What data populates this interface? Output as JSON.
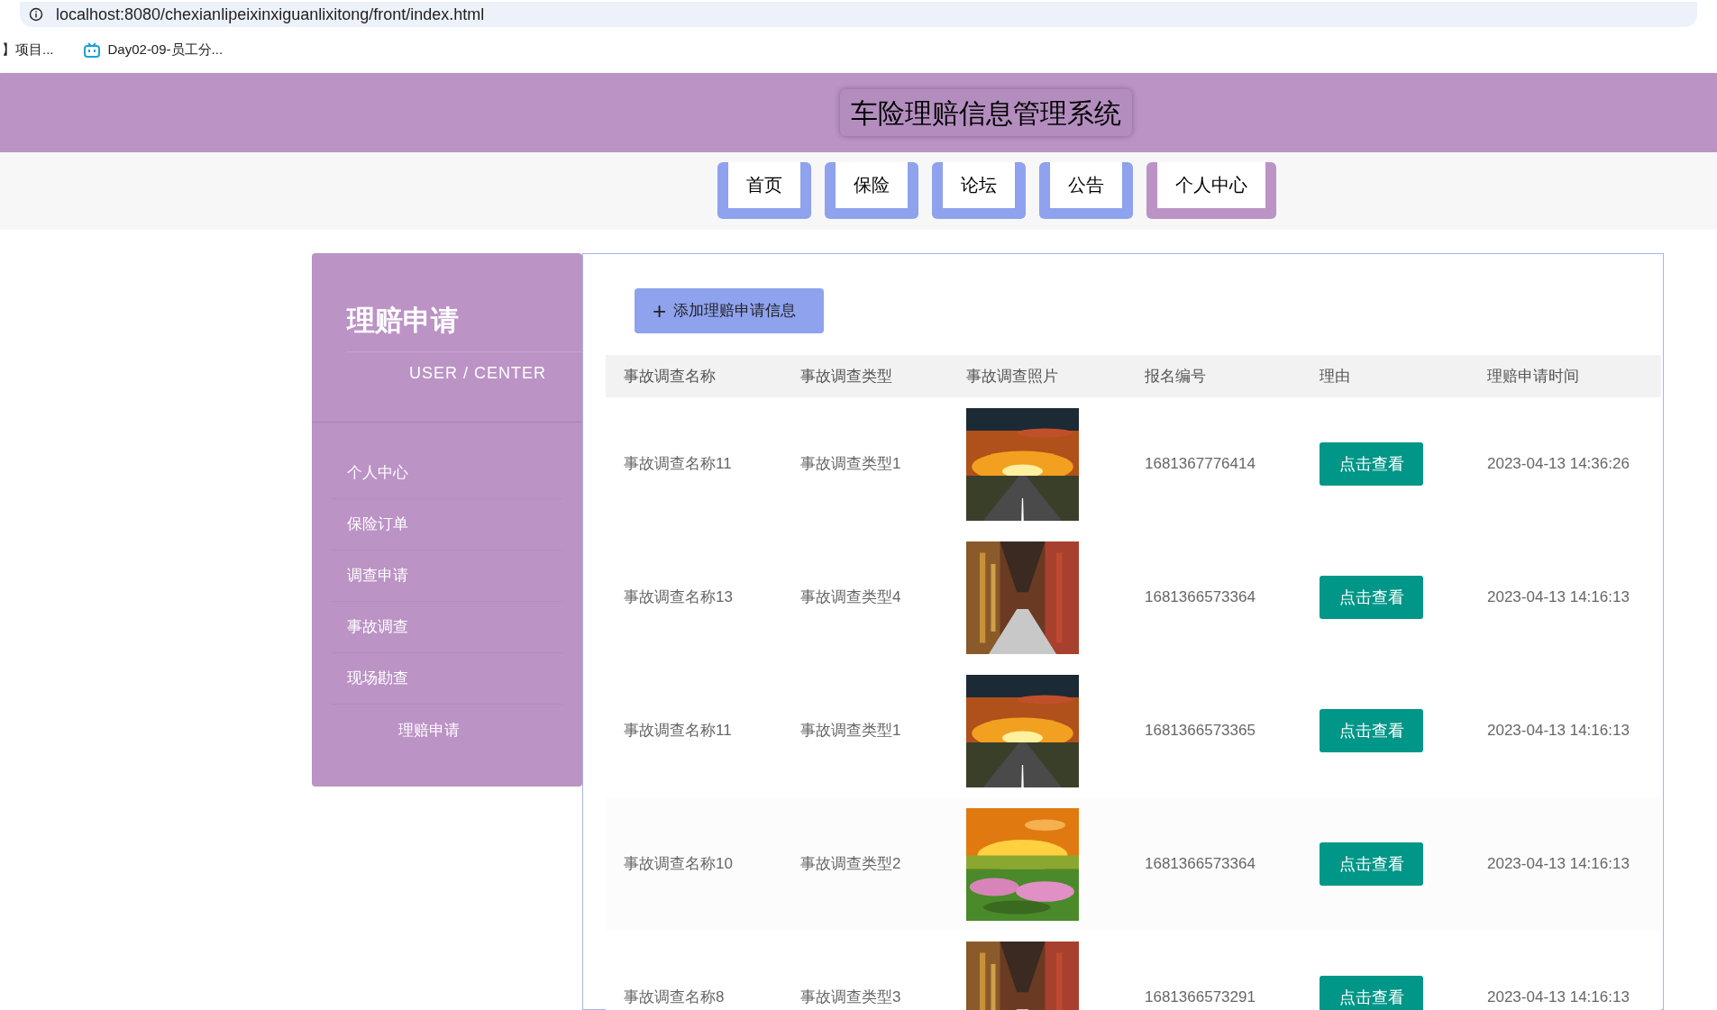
{
  "browser": {
    "url": "localhost:8080/chexianlipeixinxiguanlixitong/front/index.html",
    "bookmarks": [
      "】项目...",
      "Day02-09-员工分..."
    ]
  },
  "header": {
    "title": "车险理赔信息管理系统"
  },
  "nav": [
    {
      "label": "首页",
      "selected": false
    },
    {
      "label": "保险",
      "selected": false
    },
    {
      "label": "论坛",
      "selected": false
    },
    {
      "label": "公告",
      "selected": false
    },
    {
      "label": "个人中心",
      "selected": true
    }
  ],
  "sidebar": {
    "title": "理赔申请",
    "subtitle": "USER / CENTER",
    "items": [
      {
        "label": "个人中心",
        "selected": false
      },
      {
        "label": "保险订单",
        "selected": false
      },
      {
        "label": "调查申请",
        "selected": false
      },
      {
        "label": "事故调查",
        "selected": false
      },
      {
        "label": "现场勘查",
        "selected": false
      },
      {
        "label": "理赔申请",
        "selected": true
      }
    ]
  },
  "add_button": {
    "icon": "+",
    "label": "添加理赔申请信息"
  },
  "table": {
    "columns": [
      "事故调查名称",
      "事故调查类型",
      "事故调查照片",
      "报名编号",
      "理由",
      "理赔申请时间"
    ],
    "rows": [
      {
        "name": "事故调查名称11",
        "type": "事故调查类型1",
        "photo": {
          "kind": "road"
        },
        "number": "1681367776414",
        "reason": "点击查看",
        "time": "2023-04-13 14:36:26"
      },
      {
        "name": "事故调查名称13",
        "type": "事故调查类型4",
        "photo": {
          "kind": "corridor"
        },
        "number": "1681366573364",
        "reason": "点击查看",
        "time": "2023-04-13 14:16:13"
      },
      {
        "name": "事故调查名称11",
        "type": "事故调查类型1",
        "photo": {
          "kind": "road"
        },
        "number": "1681366573365",
        "reason": "点击查看",
        "time": "2023-04-13 14:16:13"
      },
      {
        "name": "事故调查名称10",
        "type": "事故调查类型2",
        "photo": {
          "kind": "field"
        },
        "number": "1681366573364",
        "reason": "点击查看",
        "time": "2023-04-13 14:16:13"
      },
      {
        "name": "事故调查名称8",
        "type": "事故调查类型3",
        "photo": {
          "kind": "corridor"
        },
        "number": "1681366573291",
        "reason": "点击查看",
        "time": "2023-04-13 14:16:13"
      }
    ]
  }
}
